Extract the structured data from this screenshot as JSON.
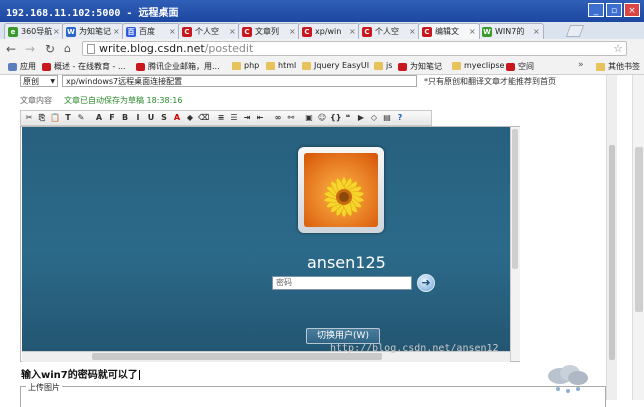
{
  "remote_desktop": {
    "title": "192.168.11.102:5000 - 远程桌面"
  },
  "tabs": [
    {
      "label": "360导航",
      "fav_color": "#3a9a2c",
      "fav_letter": "e",
      "active": false
    },
    {
      "label": "为知笔记",
      "fav_color": "#2a66c8",
      "fav_letter": "W",
      "active": false
    },
    {
      "label": "百度",
      "fav_color": "#2c5bdc",
      "fav_letter": "百",
      "active": false
    },
    {
      "label": "个人空",
      "fav_color": "#c8171d",
      "fav_letter": "C",
      "active": false
    },
    {
      "label": "文章列",
      "fav_color": "#c8171d",
      "fav_letter": "C",
      "active": false
    },
    {
      "label": "xp/win",
      "fav_color": "#c8171d",
      "fav_letter": "C",
      "active": false
    },
    {
      "label": "个人空",
      "fav_color": "#c8171d",
      "fav_letter": "C",
      "active": false
    },
    {
      "label": "编辑文",
      "fav_color": "#c8171d",
      "fav_letter": "C",
      "active": true
    },
    {
      "label": "WIN7的",
      "fav_color": "#3a9a2c",
      "fav_letter": "W",
      "active": false
    }
  ],
  "address": {
    "host": "write.blog.csdn.net",
    "path": "/postedit"
  },
  "bookmarks": [
    {
      "label": "应用",
      "type": "apps"
    },
    {
      "label": "概述 - 在线教育 - ...",
      "type": "site"
    },
    {
      "label": "腾讯企业邮箱，用...",
      "type": "site"
    },
    {
      "label": "php",
      "type": "folder"
    },
    {
      "label": "html",
      "type": "folder"
    },
    {
      "label": "Jquery EasyUI",
      "type": "folder"
    },
    {
      "label": "js",
      "type": "folder"
    },
    {
      "label": "为知笔记",
      "type": "site"
    },
    {
      "label": "myeclipse",
      "type": "folder"
    },
    {
      "label": "空间",
      "type": "site"
    }
  ],
  "bookmarks_more": "»",
  "bookmarks_other": "其他书签",
  "editor": {
    "type_select": "原创",
    "title_value": "xp/windows7远程桌面连接配置",
    "hint": "*只有原创和翻译文章才能推荐到首页",
    "content_label": "文章内容",
    "autosave": "文章已自动保存为草稿 18:38:16",
    "toolbar_icons": [
      "cut-icon",
      "copy-icon",
      "paste-icon",
      "paste-text-icon",
      "format-painter-icon",
      "font-size-icon",
      "font-family-icon",
      "bold-icon",
      "italic-icon",
      "underline-icon",
      "strikethrough-icon",
      "font-color-icon",
      "highlight-icon",
      "clear-format-icon",
      "ordered-list-icon",
      "unordered-list-icon",
      "indent-icon",
      "outdent-icon",
      "link-icon",
      "unlink-icon",
      "image-icon",
      "emoticon-icon",
      "code-icon",
      "blockquote-icon",
      "video-icon",
      "source-icon",
      "preview-icon",
      "help-icon"
    ],
    "typed_text": "输入win7的密码就可以了",
    "upload_legend": "上传图片",
    "watermark": "http://blog.csdn.net/ansen12"
  },
  "win7_login": {
    "username": "ansen125",
    "password_placeholder": "密码",
    "switch_user": "切换用户(W)",
    "go_arrow": "➜"
  },
  "colors": {
    "win7_bg": "#2c6a8a",
    "csdn_red": "#c8171d",
    "autosave_green": "#2a8a2a"
  }
}
